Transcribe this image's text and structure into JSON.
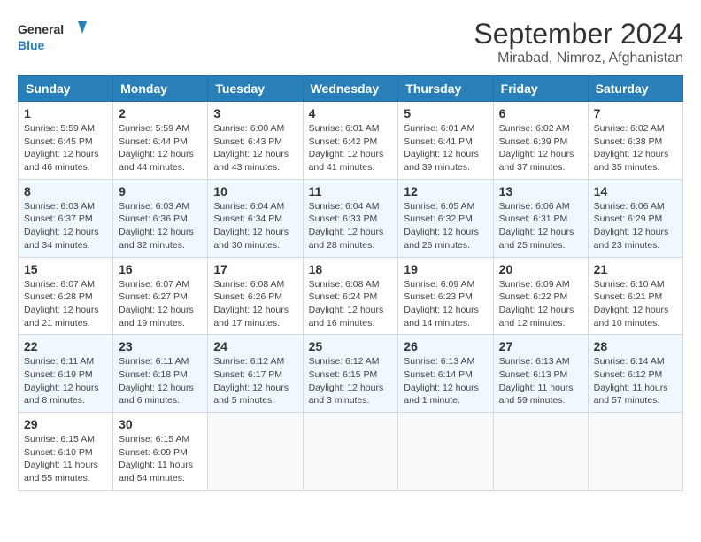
{
  "header": {
    "logo_general": "General",
    "logo_blue": "Blue",
    "title": "September 2024",
    "subtitle": "Mirabad, Nimroz, Afghanistan"
  },
  "columns": [
    "Sunday",
    "Monday",
    "Tuesday",
    "Wednesday",
    "Thursday",
    "Friday",
    "Saturday"
  ],
  "weeks": [
    [
      {
        "num": "1",
        "info": "Sunrise: 5:59 AM\nSunset: 6:45 PM\nDaylight: 12 hours and 46 minutes."
      },
      {
        "num": "2",
        "info": "Sunrise: 5:59 AM\nSunset: 6:44 PM\nDaylight: 12 hours and 44 minutes."
      },
      {
        "num": "3",
        "info": "Sunrise: 6:00 AM\nSunset: 6:43 PM\nDaylight: 12 hours and 43 minutes."
      },
      {
        "num": "4",
        "info": "Sunrise: 6:01 AM\nSunset: 6:42 PM\nDaylight: 12 hours and 41 minutes."
      },
      {
        "num": "5",
        "info": "Sunrise: 6:01 AM\nSunset: 6:41 PM\nDaylight: 12 hours and 39 minutes."
      },
      {
        "num": "6",
        "info": "Sunrise: 6:02 AM\nSunset: 6:39 PM\nDaylight: 12 hours and 37 minutes."
      },
      {
        "num": "7",
        "info": "Sunrise: 6:02 AM\nSunset: 6:38 PM\nDaylight: 12 hours and 35 minutes."
      }
    ],
    [
      {
        "num": "8",
        "info": "Sunrise: 6:03 AM\nSunset: 6:37 PM\nDaylight: 12 hours and 34 minutes."
      },
      {
        "num": "9",
        "info": "Sunrise: 6:03 AM\nSunset: 6:36 PM\nDaylight: 12 hours and 32 minutes."
      },
      {
        "num": "10",
        "info": "Sunrise: 6:04 AM\nSunset: 6:34 PM\nDaylight: 12 hours and 30 minutes."
      },
      {
        "num": "11",
        "info": "Sunrise: 6:04 AM\nSunset: 6:33 PM\nDaylight: 12 hours and 28 minutes."
      },
      {
        "num": "12",
        "info": "Sunrise: 6:05 AM\nSunset: 6:32 PM\nDaylight: 12 hours and 26 minutes."
      },
      {
        "num": "13",
        "info": "Sunrise: 6:06 AM\nSunset: 6:31 PM\nDaylight: 12 hours and 25 minutes."
      },
      {
        "num": "14",
        "info": "Sunrise: 6:06 AM\nSunset: 6:29 PM\nDaylight: 12 hours and 23 minutes."
      }
    ],
    [
      {
        "num": "15",
        "info": "Sunrise: 6:07 AM\nSunset: 6:28 PM\nDaylight: 12 hours and 21 minutes."
      },
      {
        "num": "16",
        "info": "Sunrise: 6:07 AM\nSunset: 6:27 PM\nDaylight: 12 hours and 19 minutes."
      },
      {
        "num": "17",
        "info": "Sunrise: 6:08 AM\nSunset: 6:26 PM\nDaylight: 12 hours and 17 minutes."
      },
      {
        "num": "18",
        "info": "Sunrise: 6:08 AM\nSunset: 6:24 PM\nDaylight: 12 hours and 16 minutes."
      },
      {
        "num": "19",
        "info": "Sunrise: 6:09 AM\nSunset: 6:23 PM\nDaylight: 12 hours and 14 minutes."
      },
      {
        "num": "20",
        "info": "Sunrise: 6:09 AM\nSunset: 6:22 PM\nDaylight: 12 hours and 12 minutes."
      },
      {
        "num": "21",
        "info": "Sunrise: 6:10 AM\nSunset: 6:21 PM\nDaylight: 12 hours and 10 minutes."
      }
    ],
    [
      {
        "num": "22",
        "info": "Sunrise: 6:11 AM\nSunset: 6:19 PM\nDaylight: 12 hours and 8 minutes."
      },
      {
        "num": "23",
        "info": "Sunrise: 6:11 AM\nSunset: 6:18 PM\nDaylight: 12 hours and 6 minutes."
      },
      {
        "num": "24",
        "info": "Sunrise: 6:12 AM\nSunset: 6:17 PM\nDaylight: 12 hours and 5 minutes."
      },
      {
        "num": "25",
        "info": "Sunrise: 6:12 AM\nSunset: 6:15 PM\nDaylight: 12 hours and 3 minutes."
      },
      {
        "num": "26",
        "info": "Sunrise: 6:13 AM\nSunset: 6:14 PM\nDaylight: 12 hours and 1 minute."
      },
      {
        "num": "27",
        "info": "Sunrise: 6:13 AM\nSunset: 6:13 PM\nDaylight: 11 hours and 59 minutes."
      },
      {
        "num": "28",
        "info": "Sunrise: 6:14 AM\nSunset: 6:12 PM\nDaylight: 11 hours and 57 minutes."
      }
    ],
    [
      {
        "num": "29",
        "info": "Sunrise: 6:15 AM\nSunset: 6:10 PM\nDaylight: 11 hours and 55 minutes."
      },
      {
        "num": "30",
        "info": "Sunrise: 6:15 AM\nSunset: 6:09 PM\nDaylight: 11 hours and 54 minutes."
      },
      {
        "num": "",
        "info": ""
      },
      {
        "num": "",
        "info": ""
      },
      {
        "num": "",
        "info": ""
      },
      {
        "num": "",
        "info": ""
      },
      {
        "num": "",
        "info": ""
      }
    ]
  ]
}
